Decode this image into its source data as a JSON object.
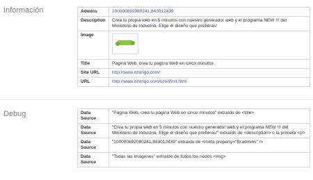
{
  "info": {
    "title": "Información",
    "rows": {
      "admins": {
        "key": "Admins",
        "value": "100000692080241,843012439"
      },
      "description": {
        "key": "Description",
        "value": "Crea tu propia web en 5 minutos con nuestro generador web y el programa NEW !!! del Ministerio de Industria. Elige el diseño que prefieras!"
      },
      "image": {
        "key": "Image"
      },
      "title": {
        "key": "Title",
        "value": "Pagina Web, crea tu pagina Web en cinco minutos"
      },
      "site_url": {
        "key": "Site URL",
        "value": "http://www.ozongo.com/"
      },
      "url": {
        "key": "URL",
        "value": "http://www.ozongo.com/ozonfirst.html"
      }
    }
  },
  "debug": {
    "title": "Debug",
    "rows": [
      {
        "key": "Data Source",
        "value": "\"Pagina Web, crea tu pagina Web en cinco minutos\" extraído de <title>"
      },
      {
        "key": "Data Source",
        "value": "\"Crea tu propia web en 5 minutos con nuestro generador web y el programa NEW !!! del Ministerio de Industria. Elige el diseño que prefieras!\" extraído de <description> o la primera <p>"
      },
      {
        "key": "Data Source",
        "value": "\"100000692080241,843012439\" extraído de <meta property=\"fb:admins\" />"
      },
      {
        "key": "Data Source",
        "value": "\"Todas las imágenes\" extraído de todos los nodos <img>"
      }
    ]
  }
}
